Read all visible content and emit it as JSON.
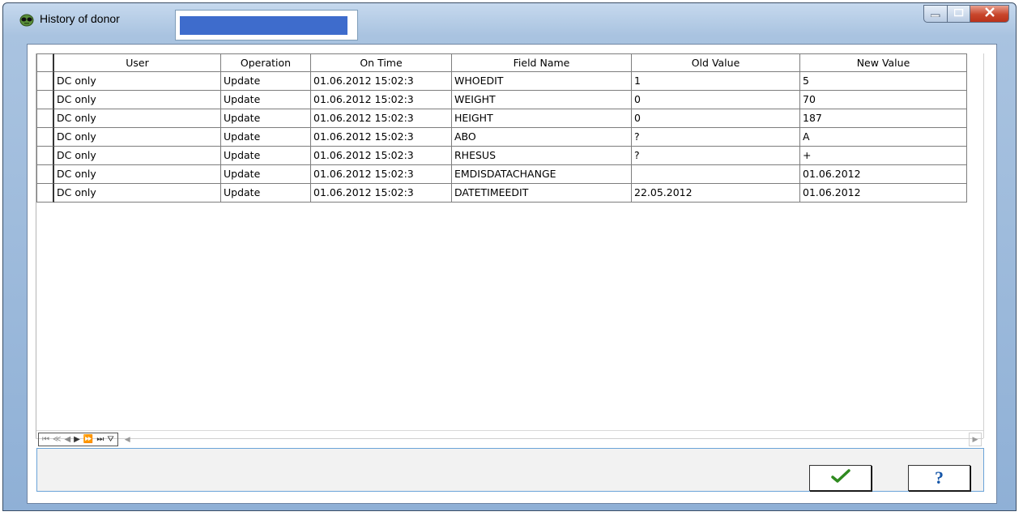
{
  "window": {
    "title": "History of donor",
    "icons": {
      "app": "alien-face-icon",
      "minimize": "minimize-icon",
      "maximize": "maximize-icon",
      "close": "close-icon"
    }
  },
  "grid": {
    "columns": [
      "User",
      "Operation",
      "On Time",
      "Field Name",
      "Old Value",
      "New Value"
    ],
    "rows": [
      [
        "DC only",
        "Update",
        "01.06.2012 15:02:3",
        "WHOEDIT",
        "1",
        "5"
      ],
      [
        "DC only",
        "Update",
        "01.06.2012 15:02:3",
        "WEIGHT",
        "0",
        "70"
      ],
      [
        "DC only",
        "Update",
        "01.06.2012 15:02:3",
        "HEIGHT",
        "0",
        "187"
      ],
      [
        "DC only",
        "Update",
        "01.06.2012 15:02:3",
        "ABO",
        "?",
        "A"
      ],
      [
        "DC only",
        "Update",
        "01.06.2012 15:02:3",
        "RHESUS",
        "?",
        "+"
      ],
      [
        "DC only",
        "Update",
        "01.06.2012 15:02:3",
        "EMDISDATACHANGE",
        "",
        "01.06.2012"
      ],
      [
        "DC only",
        "Update",
        "01.06.2012 15:02:3",
        "DATETIMEEDIT",
        "22.05.2012",
        "01.06.2012"
      ]
    ]
  },
  "navigator": {
    "first": "⏮",
    "prev_page": "≪",
    "prev": "◀",
    "next": "▶",
    "next_page": "⏩",
    "last": "⏭",
    "filter": "⛛"
  },
  "buttons": {
    "ok_icon": "checkmark-icon",
    "help_label": "?"
  },
  "colors": {
    "title_field": "#3e6ccc",
    "ok_check": "#2f8a1f",
    "help": "#1656a8",
    "panel_border": "#6aa3d8"
  }
}
